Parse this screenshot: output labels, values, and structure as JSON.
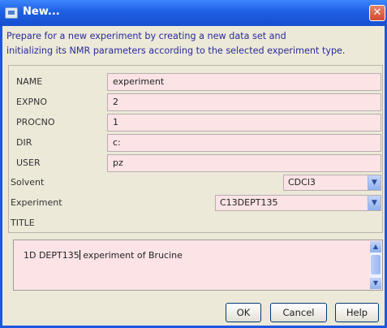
{
  "window": {
    "title": "New...",
    "close_glyph": "✕"
  },
  "intro": {
    "line1": "Prepare for a new experiment by creating a new data set and",
    "line2": "initializing its NMR parameters according to the selected experiment type."
  },
  "form": {
    "name": {
      "label": "NAME",
      "value": "experiment"
    },
    "expno": {
      "label": "EXPNO",
      "value": "2"
    },
    "procno": {
      "label": "PROCNO",
      "value": "1"
    },
    "dir": {
      "label": "DIR",
      "value": "c:"
    },
    "user": {
      "label": "USER",
      "value": "pz"
    },
    "solvent": {
      "label": "Solvent",
      "value": "CDCl3"
    },
    "experiment": {
      "label": "Experiment",
      "value": "C13DEPT135"
    },
    "title": {
      "label": "TITLE",
      "value_before_caret": "1D DEPT135",
      "value_after_caret": " experiment of Brucine"
    }
  },
  "buttons": {
    "ok": "OK",
    "cancel": "Cancel",
    "help": "Help"
  },
  "colors": {
    "field_background": "#fbe3e6",
    "dialog_background": "#ece9d8",
    "title_bar": "#1e5fe3",
    "intro_text": "#2a2a9a"
  }
}
